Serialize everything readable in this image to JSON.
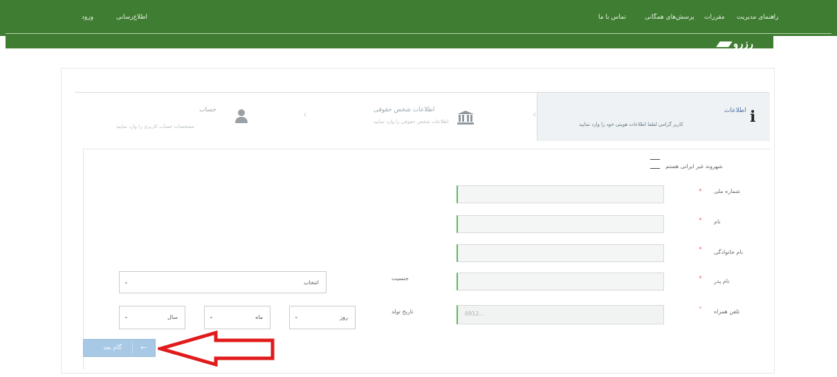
{
  "nav": {
    "right_links": [
      "راهنمای مدیریت",
      "مقررات",
      "پرسش‌های همگانی",
      "تماس با ما"
    ],
    "left_links": [
      "اطلاع‌رسانی",
      "ورود"
    ],
    "logo_text": "رزرو"
  },
  "steps": [
    {
      "title": "اطلاعات",
      "desc": "کاربر گرامی لطفا اطلاعات هویتی خود را وارد نمایید",
      "active": true
    },
    {
      "title": "اطلاعات شخص حقوقی",
      "desc": "اطلاعات شخص حقوقی را وارد نمایید",
      "active": false
    },
    {
      "title": "حساب",
      "desc": "مشخصات حساب کاربری را وارد نمایید",
      "active": false
    }
  ],
  "form": {
    "foreign_checkbox_label": "شهروند غیر ایرانی هستم",
    "national_code_label": "شماره ملی",
    "name_label": "نام",
    "family_label": "نام خانوادگی",
    "father_label": "نام پدر",
    "mobile_label": "تلفن همراه",
    "mobile_placeholder": "0912...",
    "gender_label": "جنسیت",
    "gender_value": "انتخاب",
    "birth_label": "تاریخ تولد",
    "birth_day": "روز",
    "birth_month": "ماه",
    "birth_year": "سال",
    "required_mark": "*",
    "next_button": "گام بعد"
  },
  "colors": {
    "nav": "#3f7d32",
    "button": "#a8c9e6",
    "arrow": "#e11b1b"
  }
}
